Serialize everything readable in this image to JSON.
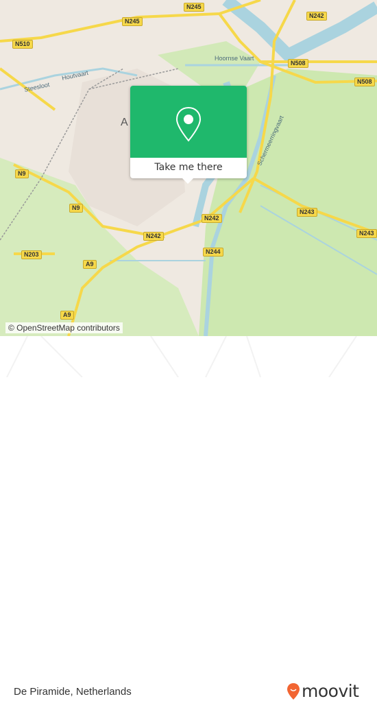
{
  "map": {
    "attribution": "© OpenStreetMap contributors",
    "road_labels": [
      "N245",
      "N245",
      "N510",
      "N242",
      "N508",
      "N508",
      "N9",
      "N9",
      "N242",
      "N242",
      "N243",
      "N243",
      "N203",
      "A9",
      "N244",
      "A9"
    ],
    "water_labels": [
      "Hoornse Vaart",
      "Houtvaart",
      "Steesloot",
      "Schermeerringvaart"
    ],
    "city_label": "A"
  },
  "popup": {
    "button_label": "Take me there",
    "icon": "map-pin-icon",
    "color": "#1fb86c"
  },
  "footer": {
    "place_name": "De Piramide, Netherlands",
    "brand": "moovit",
    "brand_color": "#f26532"
  }
}
